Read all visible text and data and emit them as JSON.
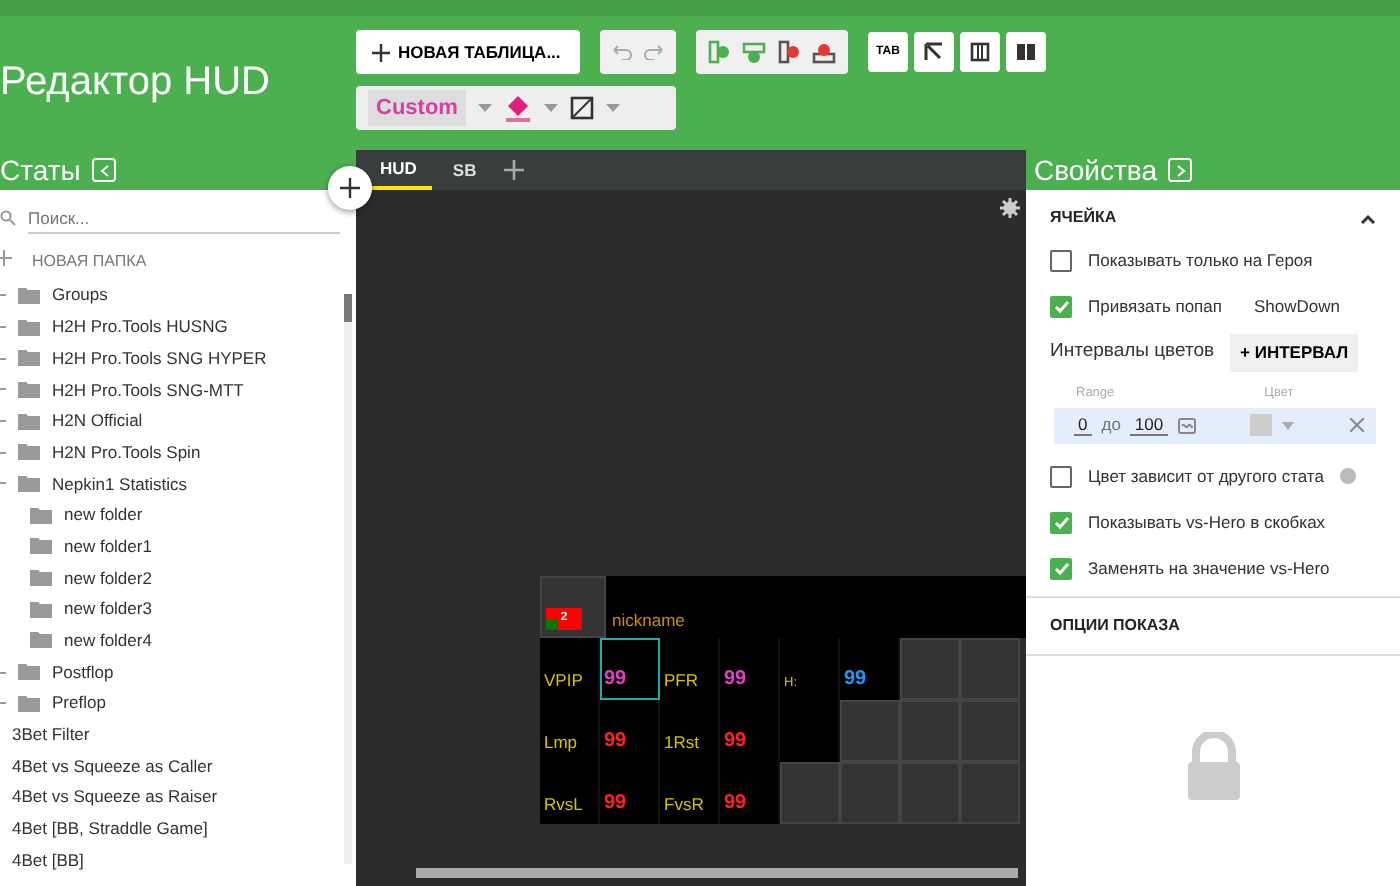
{
  "app_title": "Редактор HUD",
  "toolbar": {
    "new_table": "НОВАЯ ТАБЛИЦА...",
    "style_value": "Custom",
    "tab_button": "TAB"
  },
  "left_panel": {
    "title": "Статы",
    "search": {
      "placeholder": "Поиск..."
    },
    "new_folder": "НОВАЯ ПАПКА",
    "items": [
      {
        "kind": "folder",
        "label": "Groups",
        "expandable": true
      },
      {
        "kind": "folder",
        "label": "H2H Pro.Tools HUSNG",
        "expandable": true
      },
      {
        "kind": "folder",
        "label": "H2H Pro.Tools SNG HYPER",
        "expandable": true
      },
      {
        "kind": "folder",
        "label": "H2H Pro.Tools SNG-MTT",
        "expandable": true
      },
      {
        "kind": "folder",
        "label": "H2N Official",
        "expandable": true
      },
      {
        "kind": "folder",
        "label": "H2N Pro.Tools Spin",
        "expandable": true
      },
      {
        "kind": "folder",
        "label": "Nepkin1 Statistics",
        "expandable": true
      },
      {
        "kind": "folder",
        "label": "new folder",
        "expandable": false
      },
      {
        "kind": "folder",
        "label": "new folder1",
        "expandable": false
      },
      {
        "kind": "folder",
        "label": "new folder2",
        "expandable": false
      },
      {
        "kind": "folder",
        "label": "new folder3",
        "expandable": false
      },
      {
        "kind": "folder",
        "label": "new folder4",
        "expandable": false
      },
      {
        "kind": "folder",
        "label": "Postflop",
        "expandable": true
      },
      {
        "kind": "folder",
        "label": "Preflop",
        "expandable": true
      },
      {
        "kind": "stat",
        "label": "3Bet Filter"
      },
      {
        "kind": "stat",
        "label": "4Bet vs Squeeze as Caller"
      },
      {
        "kind": "stat",
        "label": "4Bet vs Squeeze as Raiser"
      },
      {
        "kind": "stat",
        "label": "4Bet [BB, Straddle Game]"
      },
      {
        "kind": "stat",
        "label": "4Bet [BB]"
      }
    ]
  },
  "tabs": [
    {
      "label": "HUD",
      "selected": true
    },
    {
      "label": "SB",
      "selected": false
    }
  ],
  "hud": {
    "badge": "2",
    "nickname": "nickname",
    "rows": [
      [
        {
          "kind": "label",
          "text": "VPIP"
        },
        {
          "kind": "value",
          "text": "99",
          "color": "#e040c0",
          "selected": true
        },
        {
          "kind": "label",
          "text": "PFR"
        },
        {
          "kind": "value",
          "text": "99",
          "color": "#e040c0",
          "selected": false
        },
        {
          "kind": "label",
          "text": "H:",
          "small": true
        },
        {
          "kind": "value",
          "text": "99",
          "color": "#2196f3",
          "selected": false
        },
        {
          "kind": "empty"
        },
        {
          "kind": "empty"
        }
      ],
      [
        {
          "kind": "label",
          "text": "Lmp"
        },
        {
          "kind": "value",
          "text": "99",
          "color": "#ff2020",
          "selected": false
        },
        {
          "kind": "label",
          "text": "1Rst"
        },
        {
          "kind": "value",
          "text": "99",
          "color": "#ff2020",
          "selected": false
        },
        {
          "kind": "blank"
        },
        {
          "kind": "empty"
        },
        {
          "kind": "empty"
        },
        {
          "kind": "empty"
        }
      ],
      [
        {
          "kind": "label",
          "text": "RvsL"
        },
        {
          "kind": "value",
          "text": "99",
          "color": "#ff2020",
          "selected": false
        },
        {
          "kind": "label",
          "text": "FvsR"
        },
        {
          "kind": "value",
          "text": "99",
          "color": "#ff2020",
          "selected": false
        },
        {
          "kind": "empty"
        },
        {
          "kind": "empty"
        },
        {
          "kind": "empty"
        },
        {
          "kind": "empty"
        }
      ]
    ]
  },
  "right_panel": {
    "title": "Свойства",
    "section": "ЯЧЕЙКА",
    "expanded": true,
    "options": [
      {
        "label": "Показывать только на Героя",
        "checked": false
      },
      {
        "label": "Привязать попап",
        "checked": true,
        "value": "ShowDown"
      }
    ],
    "intervals": {
      "label": "Интервалы цветов",
      "add_button": "+ ИНТЕРВАЛ",
      "range_header": "Range",
      "color_header": "Цвет",
      "from": "0",
      "to_word": "до",
      "to": "100"
    },
    "options2": [
      {
        "label": "Цвет зависит от другого стата",
        "checked": false,
        "help": true
      },
      {
        "label": "Показывать vs-Hero в скобках",
        "checked": true
      },
      {
        "label": "Заменять на значение vs-Hero",
        "checked": true
      }
    ],
    "section2": "ОПЦИИ ПОКАЗА"
  }
}
